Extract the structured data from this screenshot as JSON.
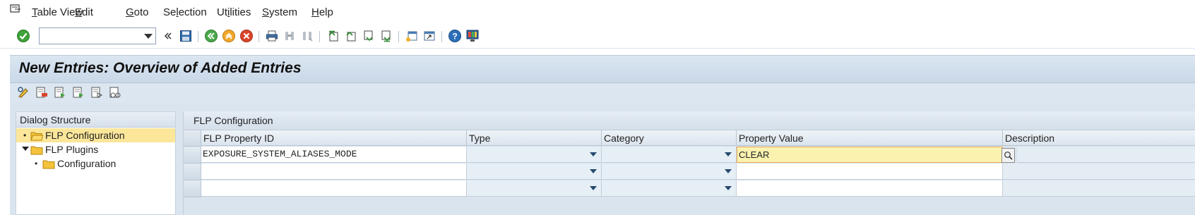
{
  "menu": {
    "items": [
      "Table View",
      "Edit",
      "Goto",
      "Selection",
      "Utilities",
      "System",
      "Help"
    ],
    "mnemonics": [
      "T",
      "E",
      "G",
      "l",
      "i",
      "S",
      "H"
    ]
  },
  "toolbar": {
    "command_field": {
      "value": "",
      "placeholder": ""
    },
    "icons": [
      "enter-icon",
      "back-double-chevron-icon",
      "save-icon",
      "back-icon",
      "exit-icon",
      "cancel-icon",
      "print-icon",
      "find-icon",
      "find-next-icon",
      "first-page-icon",
      "previous-page-icon",
      "next-page-icon",
      "last-page-icon",
      "create-session-icon",
      "shortcut-icon",
      "help-icon",
      "customize-layout-icon"
    ]
  },
  "page": {
    "title": "New Entries: Overview of Added Entries"
  },
  "app_toolbar": {
    "icons": [
      "change-display-icon",
      "delete-icon",
      "copy-as-icon",
      "select-all-icon",
      "select-block-icon",
      "deselect-all-icon"
    ]
  },
  "dialog_structure": {
    "header": "Dialog Structure",
    "nodes": [
      {
        "label": "FLP Configuration",
        "selected": true,
        "level": 0,
        "expandable": false
      },
      {
        "label": "FLP Plugins",
        "selected": false,
        "level": 0,
        "expandable": true
      },
      {
        "label": "Configuration",
        "selected": false,
        "level": 1,
        "expandable": false
      }
    ]
  },
  "table": {
    "title": "FLP Configuration",
    "columns": [
      "FLP Property ID",
      "Type",
      "Category",
      "Property Value",
      "Description"
    ],
    "rows": [
      {
        "property_id": "EXPOSURE_SYSTEM_ALIASES_MODE",
        "type": "",
        "category": "",
        "property_value": "CLEAR",
        "description": ""
      },
      {
        "property_id": "",
        "type": "",
        "category": "",
        "property_value": "",
        "description": ""
      },
      {
        "property_id": "",
        "type": "",
        "category": "",
        "property_value": "",
        "description": ""
      }
    ]
  },
  "colors": {
    "title_bg": "#dbe6f1",
    "selected_node": "#fbe69a",
    "focused_cell": "#fbf2b0",
    "folder": "#f5c33b"
  }
}
